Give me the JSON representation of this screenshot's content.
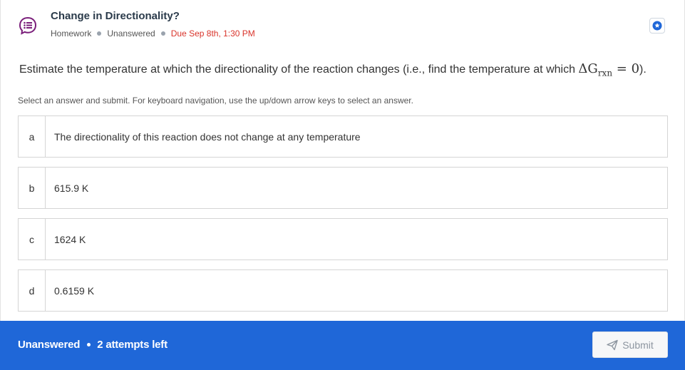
{
  "header": {
    "title": "Change in Directionality?",
    "type": "Homework",
    "status": "Unanswered",
    "due": "Due Sep 8th, 1:30 PM",
    "icons": {
      "question": "speech-bubble-list-icon",
      "star": "star-icon"
    }
  },
  "question": {
    "prompt_prefix": "Estimate the temperature at which the directionality of the reaction changes (i.e., find the temperature at which ",
    "math_main": "ΔG",
    "math_sub": "rxn",
    "math_rest": " = 0",
    "prompt_suffix": ").",
    "instructions": "Select an answer and submit. For keyboard navigation, use the up/down arrow keys to select an answer."
  },
  "options": [
    {
      "letter": "a",
      "text": "The directionality of this reaction does not change at any temperature"
    },
    {
      "letter": "b",
      "text": "615.9 K"
    },
    {
      "letter": "c",
      "text": "1624 K"
    },
    {
      "letter": "d",
      "text": "0.6159 K"
    }
  ],
  "footer": {
    "status": "Unanswered",
    "attempts": "2 attempts left",
    "submit_label": "Submit",
    "submit_icon": "paper-plane-icon"
  },
  "colors": {
    "footer_bg": "#1f67d8",
    "due_red": "#d9342b",
    "icon_purple": "#7a1e7a",
    "star_blue": "#1f67d8"
  }
}
